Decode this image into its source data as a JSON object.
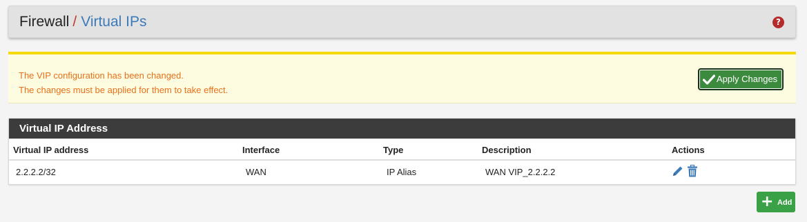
{
  "breadcrumb": {
    "section": "Firewall",
    "separator": "/",
    "page": "Virtual IPs"
  },
  "help_icon": "question-circle-icon",
  "alert": {
    "line1": "The VIP configuration has been changed.",
    "line2": "The changes must be applied for them to take effect.",
    "apply_label": "Apply Changes"
  },
  "panel": {
    "title": "Virtual IP Address",
    "columns": [
      "Virtual IP address",
      "Interface",
      "Type",
      "Description",
      "Actions"
    ],
    "rows": [
      {
        "address": "2.2.2.2/32",
        "interface": "WAN",
        "type": "IP Alias",
        "description": "WAN VIP_2.2.2.2",
        "actions": [
          "pencil-icon",
          "trash-icon"
        ]
      }
    ]
  },
  "add_label": "Add",
  "colors": {
    "link": "#3d7ab8",
    "alert_text": "#e8711b",
    "alert_border": "#f5d90b",
    "apply_button": "#3b8a3e",
    "add_button": "#3aa147",
    "panel_header": "#3c3c3c",
    "help_icon": "#b52a2a"
  }
}
